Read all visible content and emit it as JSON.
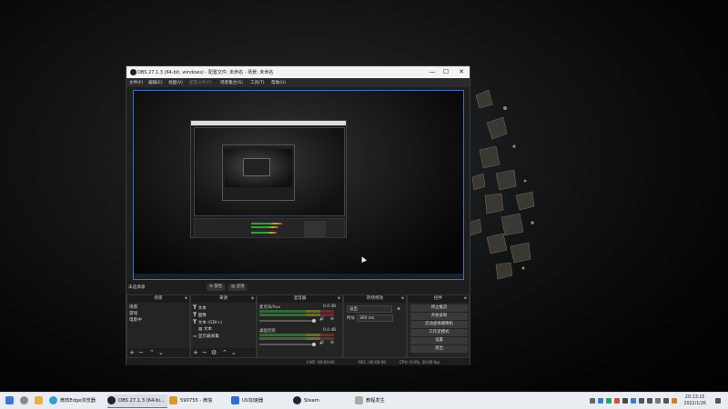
{
  "window": {
    "title": "OBS 27.1.3 (64-bit, windows) - 配置文件: 未命名 - 场景: 未命名",
    "buttons": {
      "minimize": "—",
      "maximize": "☐",
      "close": "✕"
    }
  },
  "menu": [
    "文件(F)",
    "编辑(E)",
    "视图(V)",
    "配置文件(P)",
    "场景集合(S)",
    "工具(T)",
    "帮助(H)"
  ],
  "source_bar": {
    "label": "未选择源",
    "properties": "属性",
    "filters": "滤镜"
  },
  "docks": {
    "scenes": {
      "title": "场景",
      "items": [
        "场景",
        "游戏",
        "电影中"
      ]
    },
    "sources": {
      "title": "来源",
      "items": [
        "文本",
        "图像",
        "文本 (GDI+)",
        "文本",
        "显示器采集"
      ]
    },
    "mixer": {
      "title": "混音器",
      "tracks": [
        {
          "name": "麦克风/Aux",
          "db": "0.0 dB"
        },
        {
          "name": "桌面音频",
          "db": "0.0 dB"
        }
      ]
    },
    "transitions": {
      "title": "转场特效",
      "mode": "淡出",
      "duration_label": "时长",
      "duration": "300 ms"
    },
    "controls": {
      "title": "控件",
      "buttons": [
        "停止推流",
        "开始录制",
        "启动虚拟摄像机",
        "工作室模式",
        "设置",
        "退出"
      ]
    }
  },
  "status": {
    "live": "LIVE: 00:00:00",
    "rec": "REC: 00:00:00",
    "cpu": "CPU: 0.0%, 30.00 fps"
  },
  "taskbar": {
    "items": [
      {
        "label": "(图标)",
        "icon": "windows-icon"
      },
      {
        "label": "搜索",
        "icon": "search-icon"
      },
      {
        "label": "微软Edge浏览器",
        "icon": "edge-icon"
      },
      {
        "label": "OBS 27.1.3 (64-bi...",
        "icon": "obs-icon"
      },
      {
        "label": "590755 - 微信",
        "icon": "wechat-icon"
      },
      {
        "label": "UU加速器",
        "icon": "uu-icon"
      },
      {
        "label": "Steam",
        "icon": "steam-icon"
      },
      {
        "label": "教程发生",
        "icon": "app-icon"
      }
    ],
    "clock": {
      "time": "20:13:15",
      "date": "2022/1/26"
    }
  },
  "colors": {
    "preview_border": "#3b6fb6",
    "obs_bg": "#1f1e1f",
    "taskbar_bg": "#e9ecf1"
  }
}
